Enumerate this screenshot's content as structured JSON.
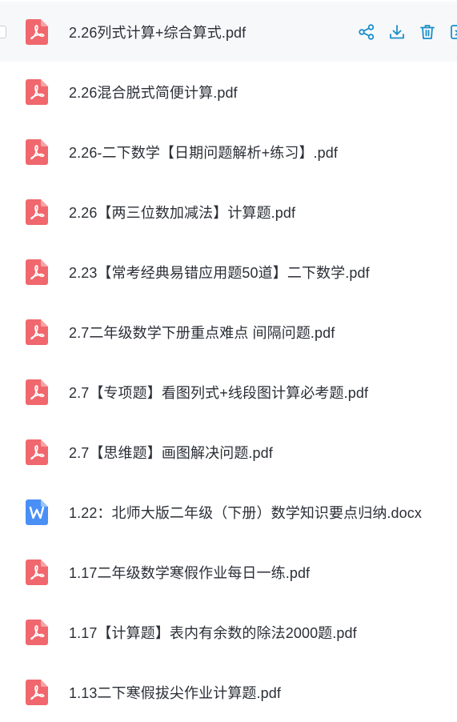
{
  "colors": {
    "accent": "#1a8fc8",
    "pdf_icon": "#f0676d",
    "doc_icon": "#4a8ff5",
    "hover_row": "#f7f8fa",
    "text": "#2b2f36"
  },
  "files": [
    {
      "name": "2.26列式计算+综合算式.pdf",
      "type": "pdf",
      "icon": "pdf-icon"
    },
    {
      "name": "2.26混合脱式简便计算.pdf",
      "type": "pdf",
      "icon": "pdf-icon"
    },
    {
      "name": "2.26-二下数学【日期问题解析+练习】.pdf",
      "type": "pdf",
      "icon": "pdf-icon"
    },
    {
      "name": "2.26【两三位数加减法】计算题.pdf",
      "type": "pdf",
      "icon": "pdf-icon"
    },
    {
      "name": "2.23【常考经典易错应用题50道】二下数学.pdf",
      "type": "pdf",
      "icon": "pdf-icon"
    },
    {
      "name": "2.7二年级数学下册重点难点 间隔问题.pdf",
      "type": "pdf",
      "icon": "pdf-icon"
    },
    {
      "name": "2.7【专项题】看图列式+线段图计算必考题.pdf",
      "type": "pdf",
      "icon": "pdf-icon"
    },
    {
      "name": "2.7【思维题】画图解决问题.pdf",
      "type": "pdf",
      "icon": "pdf-icon"
    },
    {
      "name": "1.22：北师大版二年级（下册）数学知识要点归纳.docx",
      "type": "docx",
      "icon": "word-icon"
    },
    {
      "name": "1.17二年级数学寒假作业每日一练.pdf",
      "type": "pdf",
      "icon": "pdf-icon"
    },
    {
      "name": "1.17【计算题】表内有余数的除法2000题.pdf",
      "type": "pdf",
      "icon": "pdf-icon"
    },
    {
      "name": "1.13二下寒假拔尖作业计算题.pdf",
      "type": "pdf",
      "icon": "pdf-icon"
    }
  ],
  "row_actions": [
    "share-icon",
    "download-icon",
    "delete-icon",
    "more-icon"
  ]
}
